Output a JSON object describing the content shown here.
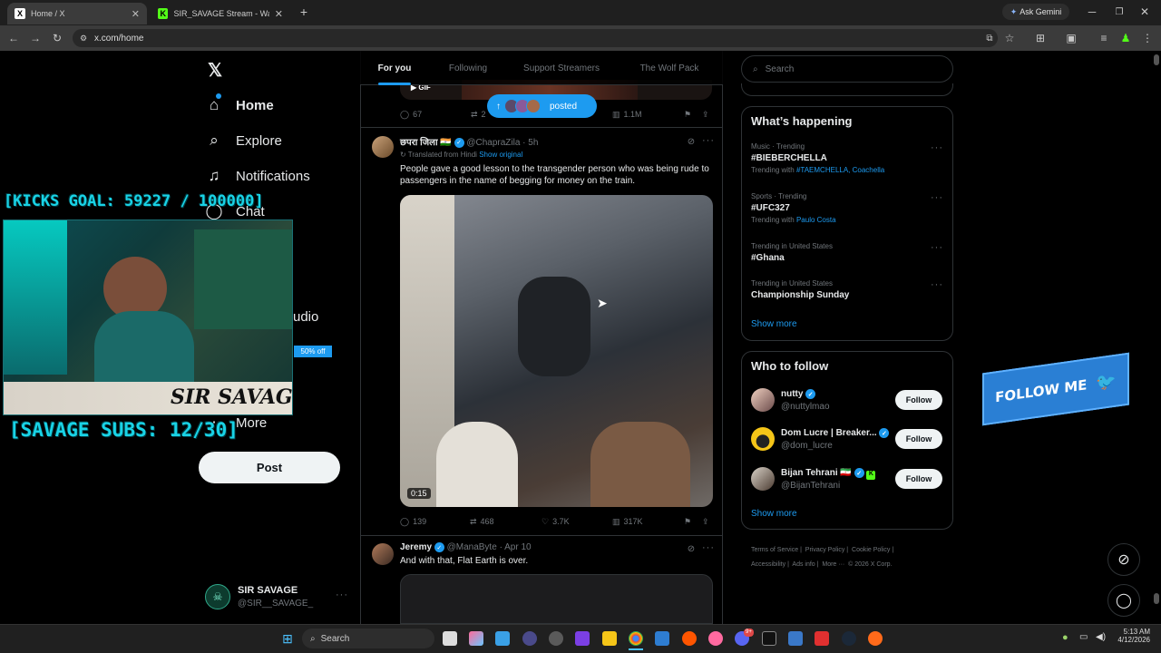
{
  "browser": {
    "tabs": [
      {
        "title": "Home / X",
        "favicon": "X"
      },
      {
        "title": "SIR_SAVAGE Stream - Watch Li",
        "favicon": "K"
      }
    ],
    "new_tab": "+",
    "url": "x.com/home",
    "ask_gemini": "Ask Gemini"
  },
  "sidebar": {
    "items": [
      {
        "label": "Home",
        "icon": "home-icon"
      },
      {
        "label": "Explore",
        "icon": "search-icon"
      },
      {
        "label": "Notifications",
        "icon": "bell-icon"
      },
      {
        "label": "Chat",
        "icon": "chat-icon"
      },
      {
        "label": "s",
        "icon": "list-icon"
      },
      {
        "label": "udio",
        "icon": "audio-icon"
      },
      {
        "label": "More",
        "icon": "more-icon"
      }
    ],
    "post_label": "Post",
    "account": {
      "name": "SIR SAVAGE",
      "handle": "@SIR__SAVAGE_"
    }
  },
  "stream_overlay": {
    "kicks_goal": "[KICKS GOAL: 59227 / 100000]",
    "subs_goal": "[SAVAGE SUBS: 12/30]",
    "logo_text": "SIR SAVAGE",
    "badge": "50% off"
  },
  "feed": {
    "tabs": [
      "For you",
      "Following",
      "Support Streamers",
      "The Wolf Pack"
    ],
    "active_tab": "For you",
    "posted_pill": "posted",
    "prev_post": {
      "gif": "GIF",
      "replies": "67",
      "reposts": "2",
      "views": "1.1M"
    },
    "post1": {
      "name": "छपरा जिला 🇮🇳",
      "handle": "@ChapraZila",
      "time": "· 5h",
      "translated": "Translated from Hindi",
      "show_original": "Show original",
      "text": "People gave a good lesson to the transgender person who was being rude to passengers in the name of begging for money on the train.",
      "duration": "0:15",
      "replies": "139",
      "reposts": "468",
      "likes": "3.7K",
      "views": "317K"
    },
    "post2": {
      "name": "Jeremy",
      "handle": "@ManaByte",
      "time": "· Apr 10",
      "text": "And with that, Flat Earth is over."
    }
  },
  "right": {
    "search_placeholder": "Search",
    "happening_title": "What’s happening",
    "trends": [
      {
        "meta": "Music · Trending",
        "title": "#BIEBERCHELLA",
        "with_label": "Trending with",
        "with": "#TAEMCHELLA, Coachella"
      },
      {
        "meta": "Sports · Trending",
        "title": "#UFC327",
        "with_label": "Trending with",
        "with": "Paulo Costa"
      },
      {
        "meta": "Trending in United States",
        "title": "#Ghana",
        "with_label": "",
        "with": ""
      },
      {
        "meta": "Trending in United States",
        "title": "Championship Sunday",
        "with_label": "",
        "with": ""
      }
    ],
    "show_more": "Show more",
    "wtf_title": "Who to follow",
    "follow_label": "Follow",
    "who_to_follow": [
      {
        "name": "nutty",
        "handle": "@nuttylmao"
      },
      {
        "name": "Dom Lucre | Breaker...",
        "handle": "@dom_lucre"
      },
      {
        "name": "Bijan Tehrani 🇮🇷",
        "handle": "@BijanTehrani"
      }
    ],
    "footer": [
      "Terms of Service",
      "Privacy Policy",
      "Cookie Policy",
      "Accessibility",
      "Ads info",
      "More ···",
      "© 2026 X Corp."
    ],
    "follow_me": "FOLLOW ME"
  },
  "taskbar": {
    "search": "Search",
    "time": "5:13 AM",
    "date": "4/12/2026",
    "notif_badge": "9+"
  },
  "colors": {
    "accent": "#1d9bf0",
    "overlay_cyan": "#19d3e6",
    "bg": "#000000"
  }
}
